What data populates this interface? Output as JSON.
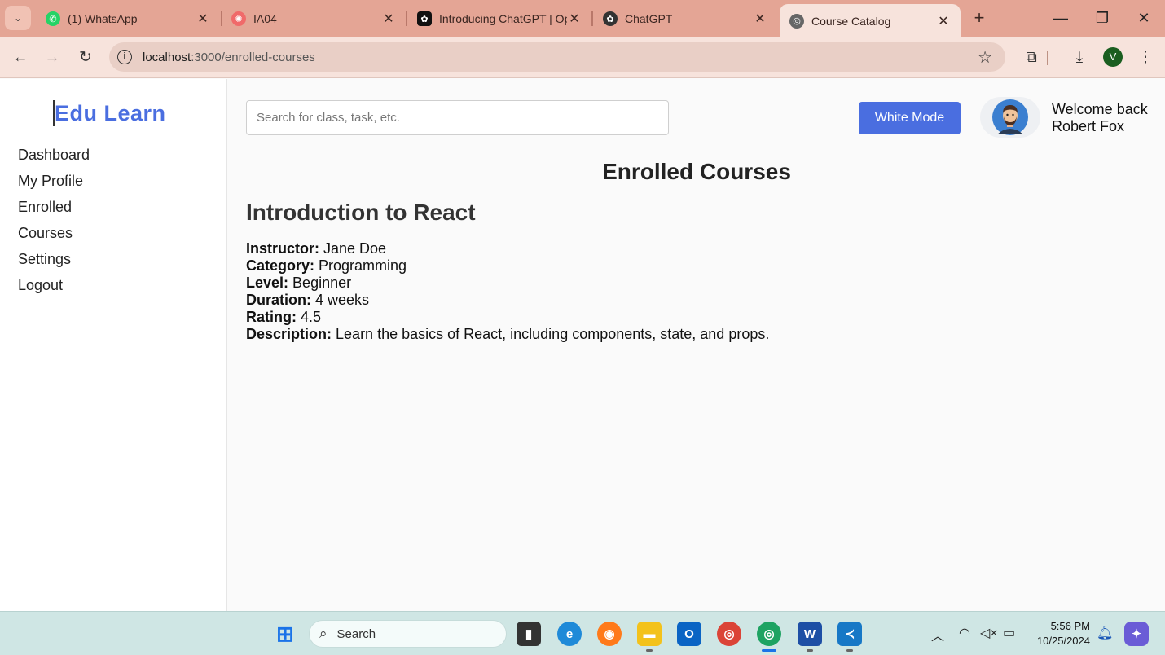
{
  "browser": {
    "tabs": [
      {
        "title": "(1) WhatsApp",
        "icon": "whatsapp-icon",
        "color": "#25d366"
      },
      {
        "title": "IA04",
        "icon": "asana-icon",
        "color": "#f06a6a"
      },
      {
        "title": "Introducing ChatGPT | Op",
        "icon": "openai-icon",
        "color": "#111111"
      },
      {
        "title": "ChatGPT",
        "icon": "openai-icon",
        "color": "#333333"
      },
      {
        "title": "Course Catalog",
        "icon": "globe-icon",
        "color": "#555555"
      }
    ],
    "url_host": "localhost",
    "url_rest": ":3000/enrolled-courses",
    "profile_initial": "V"
  },
  "sidebar": {
    "logo": "Edu Learn",
    "items": [
      {
        "label": "Dashboard"
      },
      {
        "label": "My Profile"
      },
      {
        "label": "Enrolled"
      },
      {
        "label": "Courses"
      },
      {
        "label": "Settings"
      },
      {
        "label": "Logout"
      }
    ]
  },
  "header": {
    "search_placeholder": "Search for class, task, etc.",
    "mode_button": "White Mode",
    "welcome_line1": "Welcome back",
    "welcome_line2": "Robert Fox"
  },
  "main": {
    "title": "Enrolled Courses",
    "course": {
      "name": "Introduction to React",
      "fields": [
        {
          "label": "Instructor:",
          "value": "Jane Doe"
        },
        {
          "label": "Category:",
          "value": "Programming"
        },
        {
          "label": "Level:",
          "value": "Beginner"
        },
        {
          "label": "Duration:",
          "value": "4 weeks"
        },
        {
          "label": "Rating:",
          "value": "4.5"
        },
        {
          "label": "Description:",
          "value": "Learn the basics of React, including components, state, and props."
        }
      ]
    }
  },
  "taskbar": {
    "search_label": "Search",
    "time": "5:56 PM",
    "date": "10/25/2024"
  },
  "colors": {
    "accent": "#4a6ee0",
    "tabstrip": "#e4a595",
    "taskbar": "#cfe6e4"
  }
}
